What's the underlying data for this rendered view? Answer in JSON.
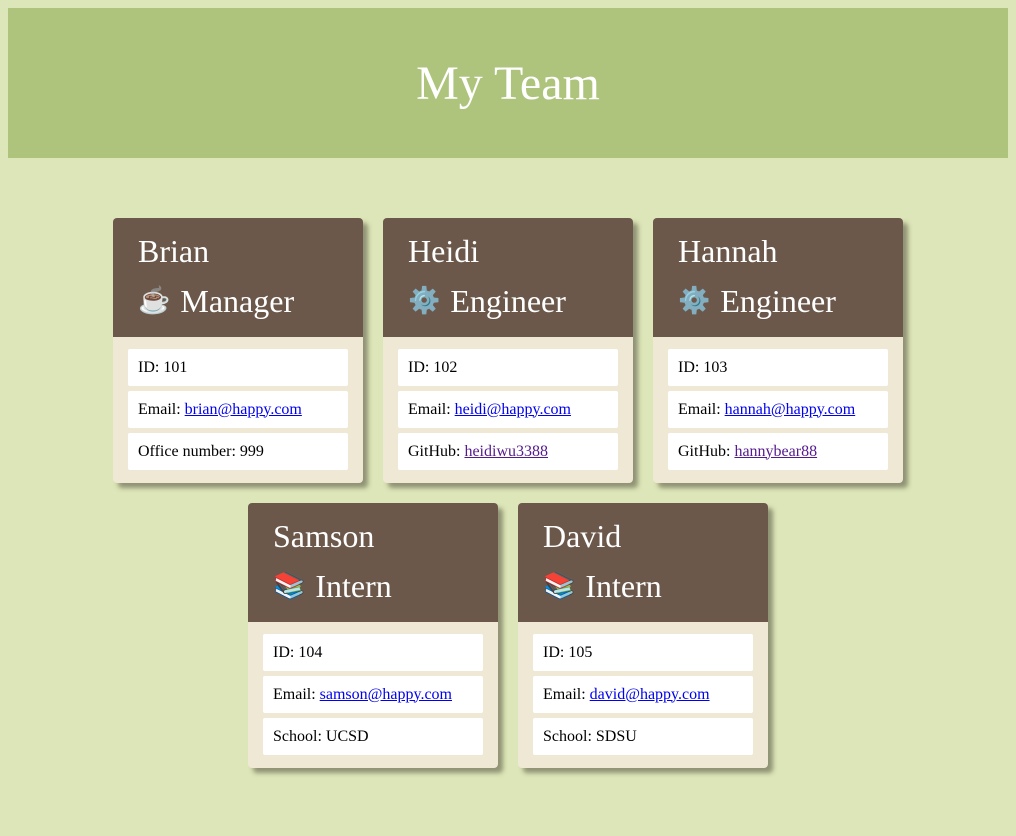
{
  "page": {
    "title": "My Team",
    "colors": {
      "background": "#dde6b8",
      "header": "#aec47c",
      "card_header": "#6b584b",
      "card_body": "#efe8d4"
    }
  },
  "team": [
    {
      "name": "Brian",
      "role": "Manager",
      "role_icon": "☕",
      "role_icon_name": "coffee-icon",
      "id_label": "ID: 101",
      "email_label": "Email:",
      "email": "brian@happy.com",
      "extra_label": "Office number: 999",
      "extra_link": ""
    },
    {
      "name": "Heidi",
      "role": "Engineer",
      "role_icon": "⚙️",
      "role_icon_name": "gear-icon",
      "id_label": "ID: 102",
      "email_label": "Email:",
      "email": "heidi@happy.com",
      "extra_label": "GitHub:",
      "extra_link": "heidiwu3388"
    },
    {
      "name": "Hannah",
      "role": "Engineer",
      "role_icon": "⚙️",
      "role_icon_name": "gear-icon",
      "id_label": "ID: 103",
      "email_label": "Email:",
      "email": "hannah@happy.com",
      "extra_label": "GitHub:",
      "extra_link": "hannybear88"
    },
    {
      "name": "Samson",
      "role": "Intern",
      "role_icon": "📚",
      "role_icon_name": "books-icon",
      "id_label": "ID: 104",
      "email_label": "Email:",
      "email": "samson@happy.com",
      "extra_label": "School: UCSD",
      "extra_link": ""
    },
    {
      "name": "David",
      "role": "Intern",
      "role_icon": "📚",
      "role_icon_name": "books-icon",
      "id_label": "ID: 105",
      "email_label": "Email:",
      "email": "david@happy.com",
      "extra_label": "School: SDSU",
      "extra_link": ""
    }
  ]
}
